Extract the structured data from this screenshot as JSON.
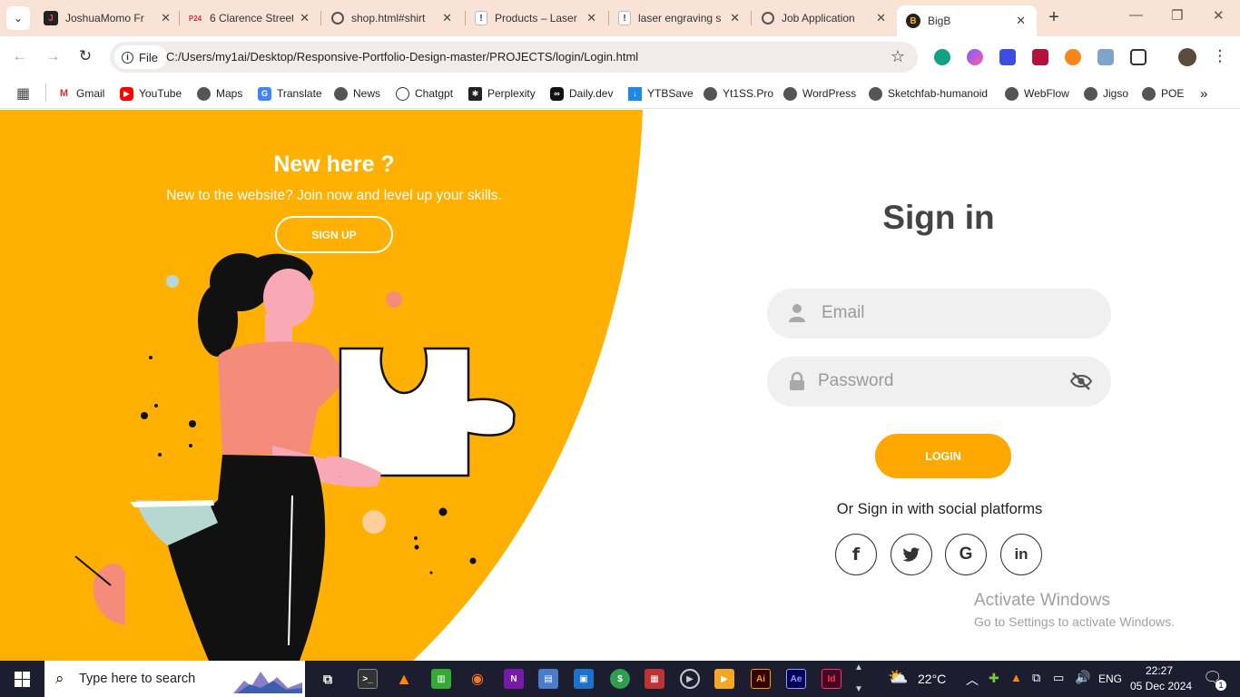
{
  "browser": {
    "tabs": [
      {
        "title": "JoshuaMomo Fr",
        "favicon": "j-logo-icon"
      },
      {
        "title": "6 Clarence Street",
        "favicon": "property24-icon"
      },
      {
        "title": "shop.html#shirt",
        "favicon": "globe-icon"
      },
      {
        "title": "Products – Laser",
        "favicon": "doc-icon"
      },
      {
        "title": "laser engraving s",
        "favicon": "doc-icon"
      },
      {
        "title": "Job Application",
        "favicon": "globe-icon"
      },
      {
        "title": "BigB",
        "favicon": "bigb-icon",
        "active": true
      }
    ],
    "site_chip": "File",
    "url": "C:/Users/my1ai/Desktop/Responsive-Portfolio-Design-master/PROJECTS/login/Login.html",
    "bookmarks": [
      "Gmail",
      "YouTube",
      "Maps",
      "Translate",
      "News",
      "Chatgpt",
      "Perplexity",
      "Daily.dev",
      "YTBSave",
      "Yt1SS.Pro",
      "WordPress",
      "Sketchfab-humanoid",
      "WebFlow",
      "Jigso",
      "POE"
    ]
  },
  "left_panel": {
    "title": "New here ?",
    "subtitle": "New to the website? Join now and level up your skills.",
    "signup_label": "SIGN UP"
  },
  "signin": {
    "title": "Sign in",
    "email_placeholder": "Email",
    "password_placeholder": "Password",
    "login_label": "LOGIN",
    "social_text": "Or Sign in with social platforms",
    "social": [
      {
        "name": "facebook",
        "glyph": "f"
      },
      {
        "name": "twitter",
        "glyph": "🐦"
      },
      {
        "name": "google",
        "glyph": "G"
      },
      {
        "name": "linkedin",
        "glyph": "in"
      }
    ]
  },
  "watermark": {
    "line1": "Activate Windows",
    "line2": "Go to Settings to activate Windows."
  },
  "taskbar": {
    "search_placeholder": "Type here to search",
    "weather": "22°C",
    "language": "ENG",
    "time": "22:27",
    "date": "05 Dec 2024",
    "notifications": "1"
  },
  "colors": {
    "accent": "#ffb000",
    "button": "#ffa800",
    "tabbar": "#f9e2d6"
  }
}
